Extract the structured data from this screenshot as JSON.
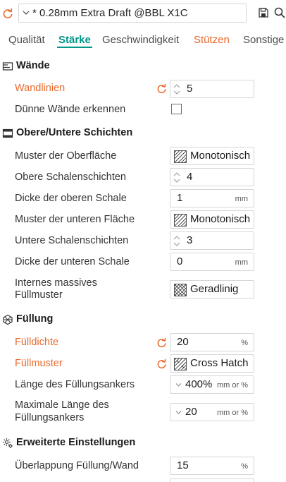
{
  "preset": {
    "name": "* 0.28mm Extra Draft @BBL X1C"
  },
  "tabs": [
    {
      "label": "Qualität",
      "state": "normal"
    },
    {
      "label": "Stärke",
      "state": "active"
    },
    {
      "label": "Geschwindigkeit",
      "state": "normal"
    },
    {
      "label": "Stützen",
      "state": "modified"
    },
    {
      "label": "Sonstige",
      "state": "normal"
    }
  ],
  "colors": {
    "accent": "#009688",
    "modified": "#e8692c",
    "border": "#d6d6d6",
    "text": "#262626"
  },
  "sections": {
    "walls": {
      "title": "Wände",
      "icon": "walls-icon",
      "wall_loops": {
        "label": "Wandlinien",
        "value": "5",
        "modified": true
      },
      "detect_thin_wall": {
        "label": "Dünne Wände erkennen",
        "checked": false
      }
    },
    "top_bottom": {
      "title": "Obere/Untere Schichten",
      "icon": "layers-icon",
      "top_pattern": {
        "label": "Muster der Oberfläche",
        "value": "Monotonisch"
      },
      "top_shells": {
        "label": "Obere Schalenschichten",
        "value": "4"
      },
      "top_thickness": {
        "label": "Dicke der oberen Schale",
        "value": "1",
        "unit": "mm"
      },
      "bottom_pattern": {
        "label": "Muster der unteren Fläche",
        "value": "Monotonisch"
      },
      "bottom_shells": {
        "label": "Untere Schalenschichten",
        "value": "3"
      },
      "bottom_thickness": {
        "label": "Dicke der unteren Schale",
        "value": "0",
        "unit": "mm"
      },
      "internal_solid_line1": "Internes massives",
      "internal_solid_line2": "Füllmuster",
      "internal_solid_value": "Geradlinig"
    },
    "infill": {
      "title": "Füllung",
      "icon": "infill-icon",
      "density": {
        "label": "Fülldichte",
        "value": "20",
        "unit": "%",
        "modified": true
      },
      "pattern": {
        "label": "Füllmuster",
        "value": "Cross Hatch",
        "modified": true
      },
      "anchor_length": {
        "label": "Länge des Füllungsankers",
        "value": "400%",
        "unit": "mm or %"
      },
      "anchor_max_line1": "Maximale Länge des",
      "anchor_max_line2": "Füllungsankers",
      "anchor_max_value": "20",
      "anchor_max_unit": "mm or %"
    },
    "advanced": {
      "title": "Erweiterte Einstellungen",
      "icon": "advanced-gear-icon",
      "overlap": {
        "label": "Überlappung Füllung/Wand",
        "value": "15",
        "unit": "%"
      }
    }
  }
}
